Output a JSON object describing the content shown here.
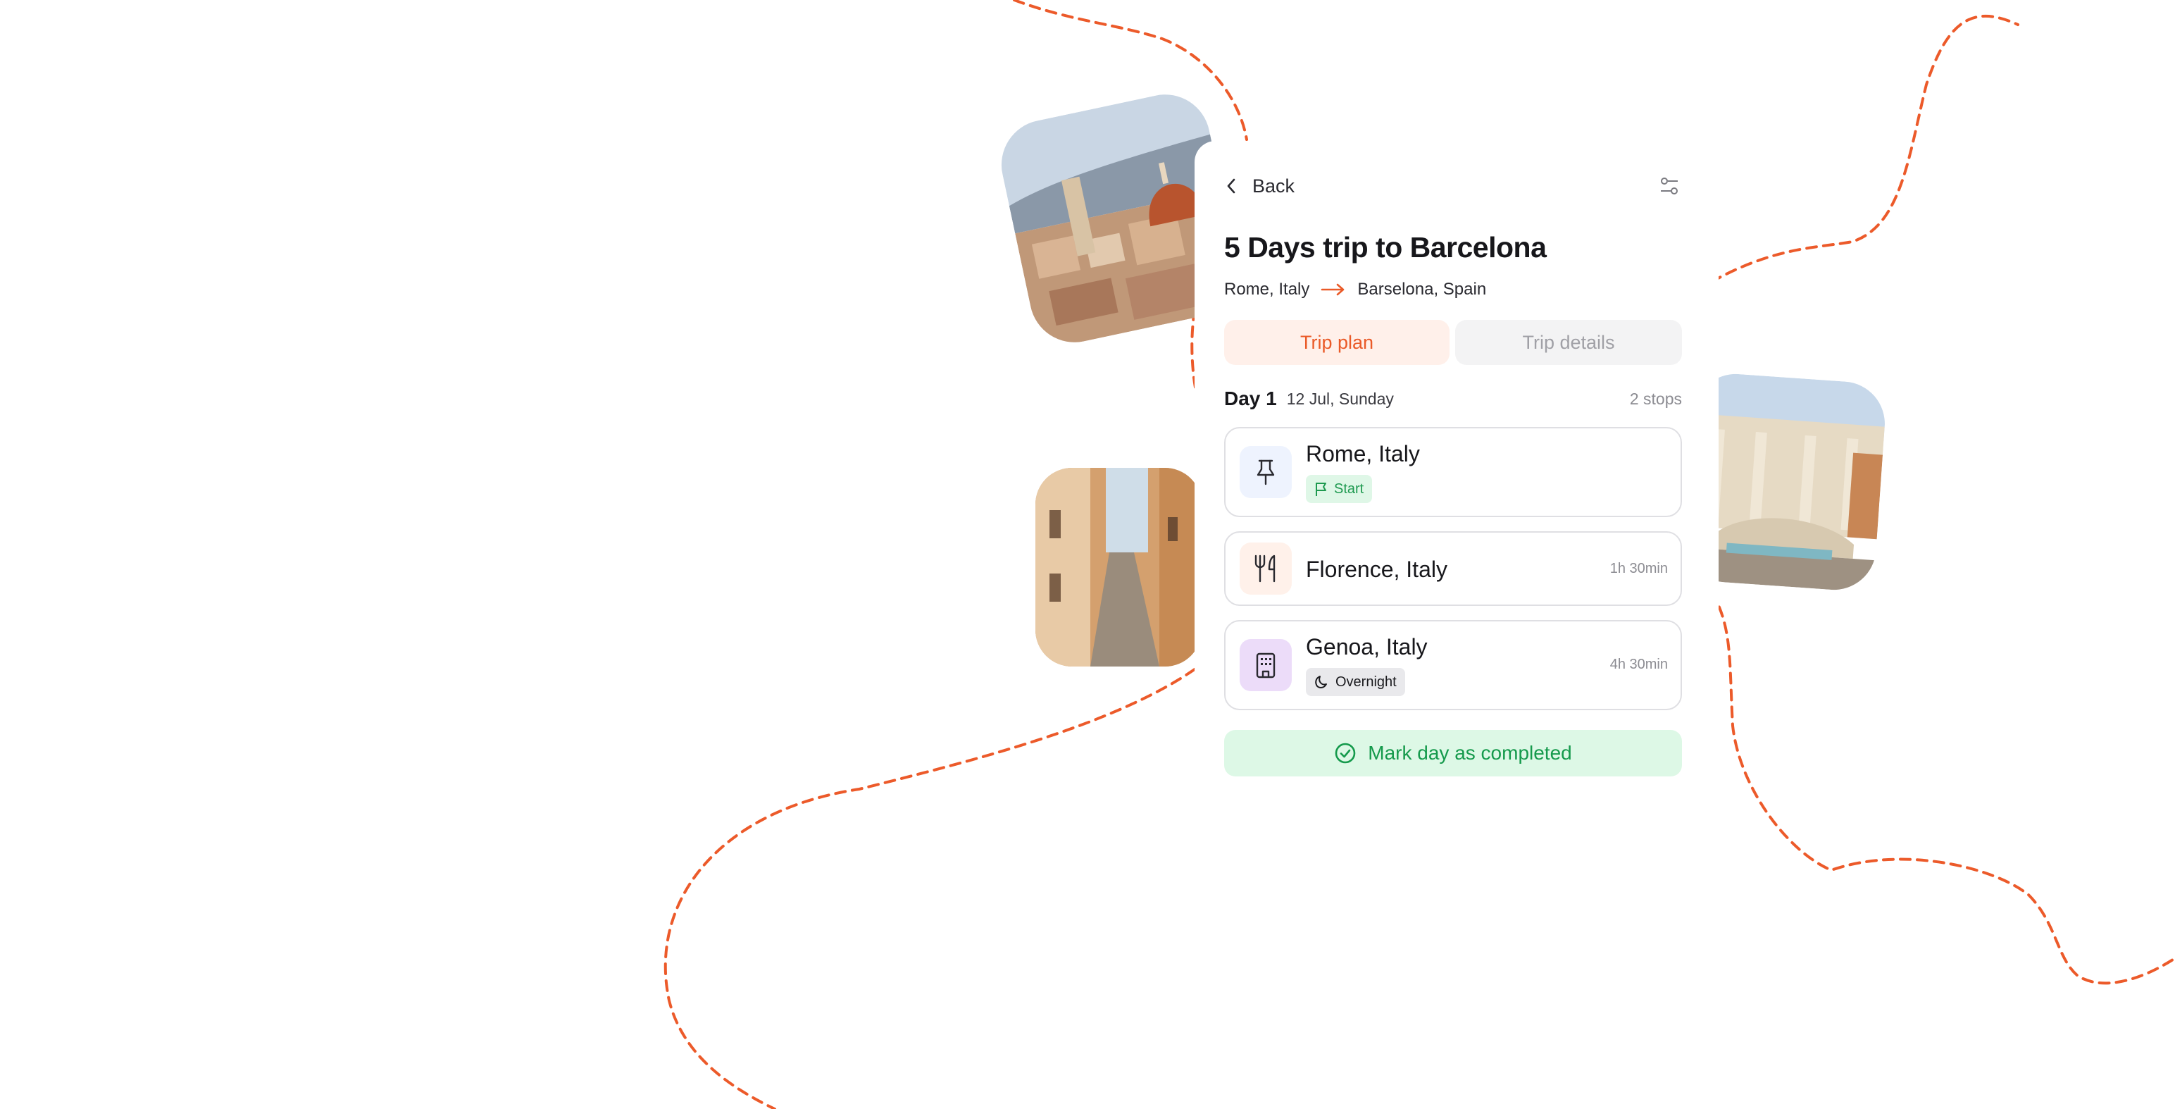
{
  "colors": {
    "accent": "#ea5a28",
    "tab_active_bg": "#fff0ea",
    "tab_inactive_bg": "#f3f3f4",
    "success_text": "#159a4c",
    "success_bg": "#ddf8e6",
    "card_border": "#dfdfe3"
  },
  "header": {
    "back_label": "Back",
    "back_icon": "chevron-left-icon",
    "filter_icon": "sliders-icon"
  },
  "trip": {
    "title": "5 Days trip to Barcelona",
    "origin": "Rome, Italy",
    "destination": "Barselona, Spain",
    "route_icon": "arrow-right-icon"
  },
  "tabs": [
    {
      "label": "Trip plan",
      "active": true
    },
    {
      "label": "Trip details",
      "active": false
    }
  ],
  "day": {
    "label": "Day 1",
    "date": "12 Jul, Sunday",
    "stops_count": "2 stops"
  },
  "stops": [
    {
      "name": "Rome, Italy",
      "icon": "pin-icon",
      "badge": {
        "label": "Start",
        "icon": "flag-icon"
      }
    },
    {
      "name": "Florence, Italy",
      "icon": "fork-knife-icon",
      "duration": "1h 30min"
    },
    {
      "name": "Genoa, Italy",
      "icon": "building-icon",
      "badge": {
        "label": "Overnight",
        "icon": "moon-icon"
      },
      "duration": "4h 30min"
    }
  ],
  "complete_button": {
    "label": "Mark day as completed",
    "icon": "check-circle-icon"
  }
}
